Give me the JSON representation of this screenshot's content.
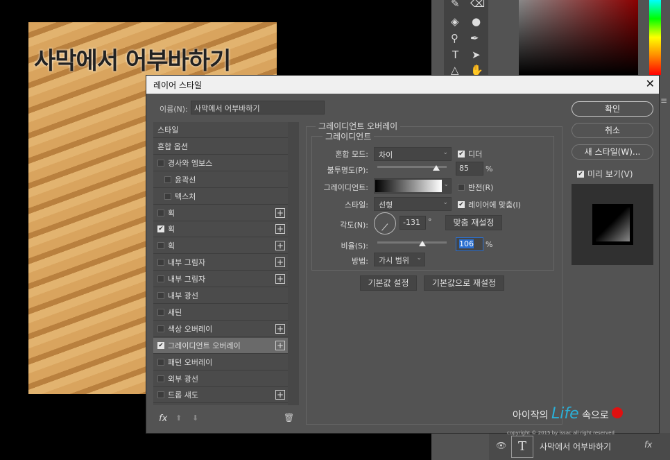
{
  "canvas": {
    "title_text": "사막에서 어부바하기"
  },
  "dialog": {
    "title": "레이어 스타일",
    "name_label": "이름(N):",
    "name_value": "사막에서 어부바하기",
    "styles": [
      {
        "label": "스타일",
        "checkbox": null,
        "plus": false,
        "indent": false
      },
      {
        "label": "혼합 옵션",
        "checkbox": null,
        "plus": false,
        "indent": false
      },
      {
        "label": "경사와 엠보스",
        "checkbox": false,
        "plus": false,
        "indent": false
      },
      {
        "label": "윤곽선",
        "checkbox": false,
        "plus": false,
        "indent": true
      },
      {
        "label": "텍스처",
        "checkbox": false,
        "plus": false,
        "indent": true
      },
      {
        "label": "획",
        "checkbox": false,
        "plus": true,
        "indent": false
      },
      {
        "label": "획",
        "checkbox": true,
        "plus": true,
        "indent": false
      },
      {
        "label": "획",
        "checkbox": false,
        "plus": true,
        "indent": false
      },
      {
        "label": "내부 그림자",
        "checkbox": false,
        "plus": true,
        "indent": false
      },
      {
        "label": "내부 그림자",
        "checkbox": false,
        "plus": true,
        "indent": false
      },
      {
        "label": "내부 광선",
        "checkbox": false,
        "plus": false,
        "indent": false
      },
      {
        "label": "새틴",
        "checkbox": false,
        "plus": false,
        "indent": false
      },
      {
        "label": "색상 오버레이",
        "checkbox": false,
        "plus": true,
        "indent": false
      },
      {
        "label": "그레이디언트 오버레이",
        "checkbox": true,
        "plus": true,
        "indent": false,
        "selected": true
      },
      {
        "label": "패턴 오버레이",
        "checkbox": false,
        "plus": false,
        "indent": false
      },
      {
        "label": "외부 광선",
        "checkbox": false,
        "plus": false,
        "indent": false
      },
      {
        "label": "드롭 섀도",
        "checkbox": false,
        "plus": true,
        "indent": false
      }
    ],
    "fx_label": "fx",
    "section_title": "그레이디언트 오버레이",
    "group_title": "그레이디언트",
    "blend_mode_label": "혼합 모드:",
    "blend_mode_value": "차이",
    "dither_label": "디더",
    "dither_checked": true,
    "opacity_label": "불투명도(P):",
    "opacity_value": "85",
    "percent": "%",
    "gradient_label": "그레이디언트:",
    "reverse_label": "반전(R)",
    "reverse_checked": false,
    "style_label": "스타일:",
    "style_value": "선형",
    "align_label": "레이어에 맞춤(I)",
    "align_checked": true,
    "angle_label": "각도(N):",
    "angle_value": "-131",
    "degree": "°",
    "reset_align_label": "맞춤 재설정",
    "scale_label": "비율(S):",
    "scale_value": "106",
    "method_label": "방법:",
    "method_value": "가시 범위",
    "make_default_label": "기본값 설정",
    "reset_default_label": "기본값으로 재설정",
    "ok_label": "확인",
    "cancel_label": "취소",
    "new_style_label": "새 스타일(W)...",
    "preview_label": "미리 보기(V)",
    "preview_checked": true
  },
  "watermark": {
    "text1": "아이작의",
    "text2": "Life",
    "text3": "속으로",
    "copyright": "copyright © 2015 by issac all right reserved"
  },
  "layers": {
    "layer_name": "사막에서 어부바하기",
    "fx": "fx"
  }
}
